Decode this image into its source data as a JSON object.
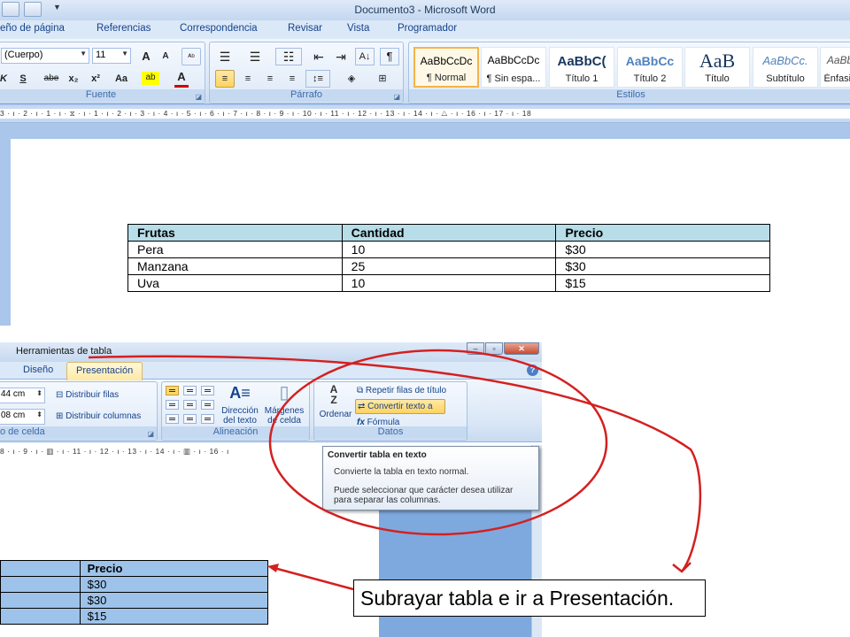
{
  "window": {
    "title": "Documento3 - Microsoft Word",
    "tabs": [
      "eño de página",
      "Referencias",
      "Correspondencia",
      "Revisar",
      "Vista",
      "Programador"
    ]
  },
  "font_group": {
    "font_name": "(Cuerpo)",
    "font_size": "11",
    "grow": "A",
    "shrink": "A",
    "clear_format": "ᴬᵇ",
    "strike_label": "abe",
    "sub_label": "x₂",
    "sup_label": "x²",
    "case_label": "Aa",
    "underline": "S",
    "highlight": "ab",
    "font_color": "A",
    "label": "Fuente"
  },
  "paragraph_group": {
    "label": "Párrafo",
    "pilcrow": "¶"
  },
  "styles_group": {
    "label": "Estilos",
    "items": [
      {
        "sample": "AaBbCcDc",
        "name": "¶ Normal"
      },
      {
        "sample": "AaBbCcDc",
        "name": "¶ Sin espa..."
      },
      {
        "sample": "AaBbC(",
        "name": "Título 1"
      },
      {
        "sample": "AaBbCc",
        "name": "Título 2"
      },
      {
        "sample": "AaB",
        "name": "Título"
      },
      {
        "sample": "AaBbCc.",
        "name": "Subtítulo"
      },
      {
        "sample": "AaBb",
        "name": "Énfasis"
      }
    ]
  },
  "ruler": {
    "top": "3 · ı · 2 · ı · 1 · ı · ⧖ · ı · 1 · ı · 2 · ı · 3 · ı · 4 · ı · 5 · ı · 6 · ı · 7 · ı · 8 · ı · 9 · ı · 10 · ı · 11 · ı · 12 · ı · 13 · ı · 14 · ı · △ · ı · 16 · ı · 17 · ı · 18",
    "bottom": "8 · ı · 9 · ı · ▥ · ı · 11 · ı · 12 · ı · 13 · ı · 14 · ı · ▥ · ı · 16 · ı"
  },
  "doc_table": {
    "headers": [
      "Frutas",
      "Cantidad",
      "Precio"
    ],
    "rows": [
      [
        "Pera",
        "10",
        "$30"
      ],
      [
        "Manzana",
        "25",
        "$30"
      ],
      [
        "Uva",
        "10",
        "$15"
      ]
    ]
  },
  "table_tools": {
    "title": "Herramientas de tabla",
    "tabs": [
      "Diseño",
      "Presentación"
    ],
    "active_tab": "Presentación",
    "height_value": "44 cm",
    "width_value": "08 cm",
    "distribute_rows": "Distribuir filas",
    "distribute_columns": "Distribuir columnas",
    "cell_size_label": "o de celda",
    "text_direction": [
      "Dirección",
      "del texto"
    ],
    "cell_margins": [
      "Márgenes",
      "de celda"
    ],
    "alignment_label": "Alineación",
    "sort": "Ordenar",
    "repeat_header": "Repetir filas de título",
    "convert_to_text": "Convertir texto a",
    "formula": "Fórmula",
    "data_label": "Datos",
    "sort_icon_text": "A\nZ",
    "help": "?"
  },
  "tooltip": {
    "title": "Convertir tabla en texto",
    "line1": "Convierte la tabla en texto normal.",
    "line2": "Puede seleccionar que carácter desea utilizar",
    "line3": "para separar las columnas."
  },
  "partial_table": {
    "header": "Precio",
    "values": [
      "$30",
      "$30",
      "$15"
    ]
  },
  "callout": {
    "text": "Subrayar tabla e ir a Presentación."
  },
  "colors": {
    "annotation": "#d42020",
    "table_header": "#b6dde8",
    "selected_table": "#9ec3ea",
    "ribbon_text": "#15428b"
  }
}
